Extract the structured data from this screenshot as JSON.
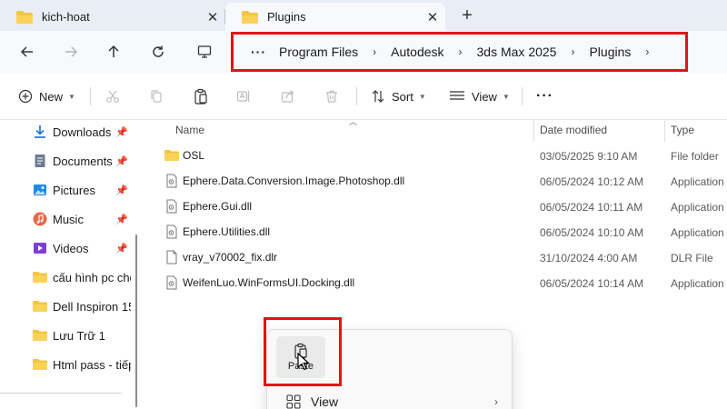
{
  "tabs": [
    {
      "label": "kich-hoat",
      "close": "✕"
    },
    {
      "label": "Plugins",
      "close": "✕"
    }
  ],
  "new_tab": "+",
  "breadcrumb": {
    "more": "···",
    "items": [
      "Program Files",
      "Autodesk",
      "3ds Max 2025",
      "Plugins"
    ]
  },
  "commands": {
    "new": "New",
    "sort": "Sort",
    "view": "View",
    "more": "···"
  },
  "sidebar": {
    "items": [
      {
        "label": "Downloads",
        "icon": "download-icon",
        "pinned": true
      },
      {
        "label": "Documents",
        "icon": "documents-icon",
        "pinned": true
      },
      {
        "label": "Pictures",
        "icon": "pictures-icon",
        "pinned": true
      },
      {
        "label": "Music",
        "icon": "music-icon",
        "pinned": true
      },
      {
        "label": "Videos",
        "icon": "videos-icon",
        "pinned": true
      },
      {
        "label": "cấu hình pc chơ",
        "icon": "folder-icon",
        "pinned": false
      },
      {
        "label": "Dell Inspiron 15-",
        "icon": "folder-icon",
        "pinned": false
      },
      {
        "label": "Lưu Trữ 1",
        "icon": "folder-icon",
        "pinned": false
      },
      {
        "label": "Html pass - tiếp",
        "icon": "folder-icon",
        "pinned": false
      }
    ]
  },
  "columns": {
    "name": "Name",
    "date": "Date modified",
    "type": "Type"
  },
  "files": [
    {
      "name": "OSL",
      "date": "03/05/2025 9:10 AM",
      "type": "File folder",
      "kind": "folder"
    },
    {
      "name": "Ephere.Data.Conversion.Image.Photoshop.dll",
      "date": "06/05/2024 10:12 AM",
      "type": "Application",
      "kind": "dll"
    },
    {
      "name": "Ephere.Gui.dll",
      "date": "06/05/2024 10:11 AM",
      "type": "Application",
      "kind": "dll"
    },
    {
      "name": "Ephere.Utilities.dll",
      "date": "06/05/2024 10:10 AM",
      "type": "Application",
      "kind": "dll"
    },
    {
      "name": "vray_v70002_fix.dlr",
      "date": "31/10/2024 4:00 AM",
      "type": "DLR File",
      "kind": "file"
    },
    {
      "name": "WeifenLuo.WinFormsUI.Docking.dll",
      "date": "06/05/2024 10:14 AM",
      "type": "Application",
      "kind": "dll"
    }
  ],
  "context_menu": {
    "paste": "Paste",
    "view": "View"
  },
  "colors": {
    "highlight": "#e2121a",
    "folder": "#f4c542",
    "tabstrip": "#e9eef6"
  }
}
